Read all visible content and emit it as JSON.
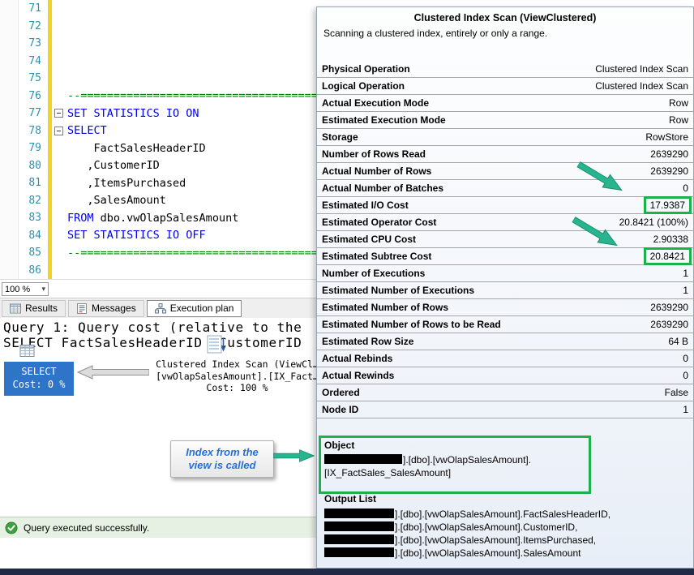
{
  "editor": {
    "zoom": "100 %",
    "lines": [
      {
        "n": "71",
        "bar": true,
        "fold": false,
        "segs": []
      },
      {
        "n": "72",
        "bar": true,
        "fold": false,
        "segs": []
      },
      {
        "n": "73",
        "bar": true,
        "fold": false,
        "segs": []
      },
      {
        "n": "74",
        "bar": true,
        "fold": false,
        "segs": []
      },
      {
        "n": "75",
        "bar": true,
        "fold": false,
        "segs": []
      },
      {
        "n": "76",
        "bar": true,
        "fold": false,
        "segs": [
          {
            "t": "--==========================================================",
            "c": "comment"
          }
        ]
      },
      {
        "n": "77",
        "bar": true,
        "fold": true,
        "segs": [
          {
            "t": "SET STATISTICS IO ON",
            "c": "kw"
          }
        ]
      },
      {
        "n": "78",
        "bar": true,
        "fold": true,
        "segs": [
          {
            "t": "SELECT",
            "c": "kw"
          }
        ]
      },
      {
        "n": "79",
        "bar": true,
        "fold": false,
        "segs": [
          {
            "t": "    FactSalesHeaderID",
            "c": "id"
          }
        ]
      },
      {
        "n": "80",
        "bar": true,
        "fold": false,
        "segs": [
          {
            "t": "   ,CustomerID",
            "c": "id"
          }
        ]
      },
      {
        "n": "81",
        "bar": true,
        "fold": false,
        "segs": [
          {
            "t": "   ,ItemsPurchased",
            "c": "id"
          }
        ]
      },
      {
        "n": "82",
        "bar": true,
        "fold": false,
        "segs": [
          {
            "t": "   ,SalesAmount",
            "c": "id"
          }
        ]
      },
      {
        "n": "83",
        "bar": true,
        "fold": false,
        "segs": [
          {
            "t": "FROM",
            "c": "kw"
          },
          {
            "t": " dbo.vwOlapSalesAmount",
            "c": "id"
          }
        ]
      },
      {
        "n": "84",
        "bar": true,
        "fold": false,
        "segs": [
          {
            "t": "SET STATISTICS IO OFF",
            "c": "kw"
          }
        ]
      },
      {
        "n": "85",
        "bar": true,
        "fold": false,
        "segs": [
          {
            "t": "--==========================================================",
            "c": "comment"
          }
        ]
      },
      {
        "n": "86",
        "bar": true,
        "fold": false,
        "segs": []
      }
    ]
  },
  "tabs": [
    {
      "label": "Results",
      "icon": "results-grid-icon",
      "selected": false
    },
    {
      "label": "Messages",
      "icon": "messages-icon",
      "selected": false
    },
    {
      "label": "Execution plan",
      "icon": "execution-plan-icon",
      "selected": true
    }
  ],
  "plan": {
    "header_line1": "Query 1: Query cost (relative to the",
    "header_line2": "SELECT FactSalesHeaderID ,CustomerID",
    "select_node": {
      "label": "SELECT",
      "cost": "Cost: 0 %"
    },
    "scan_node": {
      "line1": "Clustered Index Scan (ViewCl…",
      "line2": "[vwOlapSalesAmount].[IX_Fact…",
      "line3": "Cost: 100 %"
    },
    "annotation": {
      "line1": "Index from the",
      "line2": "view is called"
    }
  },
  "status_bar": {
    "message": "Query executed successfully."
  },
  "tooltip": {
    "title": "Clustered Index Scan (ViewClustered)",
    "subtitle": "Scanning a clustered index, entirely or only a range.",
    "rows": [
      {
        "label": "Physical Operation",
        "value": "Clustered Index Scan",
        "highlight": false
      },
      {
        "label": "Logical Operation",
        "value": "Clustered Index Scan",
        "highlight": false
      },
      {
        "label": "Actual Execution Mode",
        "value": "Row",
        "highlight": false
      },
      {
        "label": "Estimated Execution Mode",
        "value": "Row",
        "highlight": false
      },
      {
        "label": "Storage",
        "value": "RowStore",
        "highlight": false
      },
      {
        "label": "Number of Rows Read",
        "value": "2639290",
        "highlight": false
      },
      {
        "label": "Actual Number of Rows",
        "value": "2639290",
        "highlight": false
      },
      {
        "label": "Actual Number of Batches",
        "value": "0",
        "highlight": false
      },
      {
        "label": "Estimated I/O Cost",
        "value": "17.9387",
        "highlight": true
      },
      {
        "label": "Estimated Operator Cost",
        "value": "20.8421 (100%)",
        "highlight": false
      },
      {
        "label": "Estimated CPU Cost",
        "value": "2.90338",
        "highlight": false
      },
      {
        "label": "Estimated Subtree Cost",
        "value": "20.8421",
        "highlight": true
      },
      {
        "label": "Number of Executions",
        "value": "1",
        "highlight": false
      },
      {
        "label": "Estimated Number of Executions",
        "value": "1",
        "highlight": false
      },
      {
        "label": "Estimated Number of Rows",
        "value": "2639290",
        "highlight": false
      },
      {
        "label": "Estimated Number of Rows to be Read",
        "value": "2639290",
        "highlight": false
      },
      {
        "label": "Estimated Row Size",
        "value": "64 B",
        "highlight": false
      },
      {
        "label": "Actual Rebinds",
        "value": "0",
        "highlight": false
      },
      {
        "label": "Actual Rewinds",
        "value": "0",
        "highlight": false
      },
      {
        "label": "Ordered",
        "value": "False",
        "highlight": false
      },
      {
        "label": "Node ID",
        "value": "1",
        "highlight": false
      }
    ],
    "object_section": {
      "header": "Object",
      "line1_after_redaction": "].[dbo].[vwOlapSalesAmount].",
      "line2": "[IX_FactSales_SalesAmount]"
    },
    "output_list": {
      "header": "Output List",
      "items": [
        "].[dbo].[vwOlapSalesAmount].FactSalesHeaderID,",
        "].[dbo].[vwOlapSalesAmount].CustomerID,",
        "].[dbo].[vwOlapSalesAmount].ItemsPurchased,",
        "].[dbo].[vwOlapSalesAmount].SalesAmount"
      ]
    }
  },
  "colors": {
    "keyword_blue": "#0000f0",
    "comment_green": "#008000",
    "line_number_teal": "#2b91af",
    "change_bar_yellow": "#f3d321",
    "highlight_green": "#1cb14b",
    "arrow_green": "#27b48e",
    "select_node_blue": "#2e74c9",
    "annotation_blue": "#2b6fd4",
    "status_check_green": "#3ea13f"
  }
}
